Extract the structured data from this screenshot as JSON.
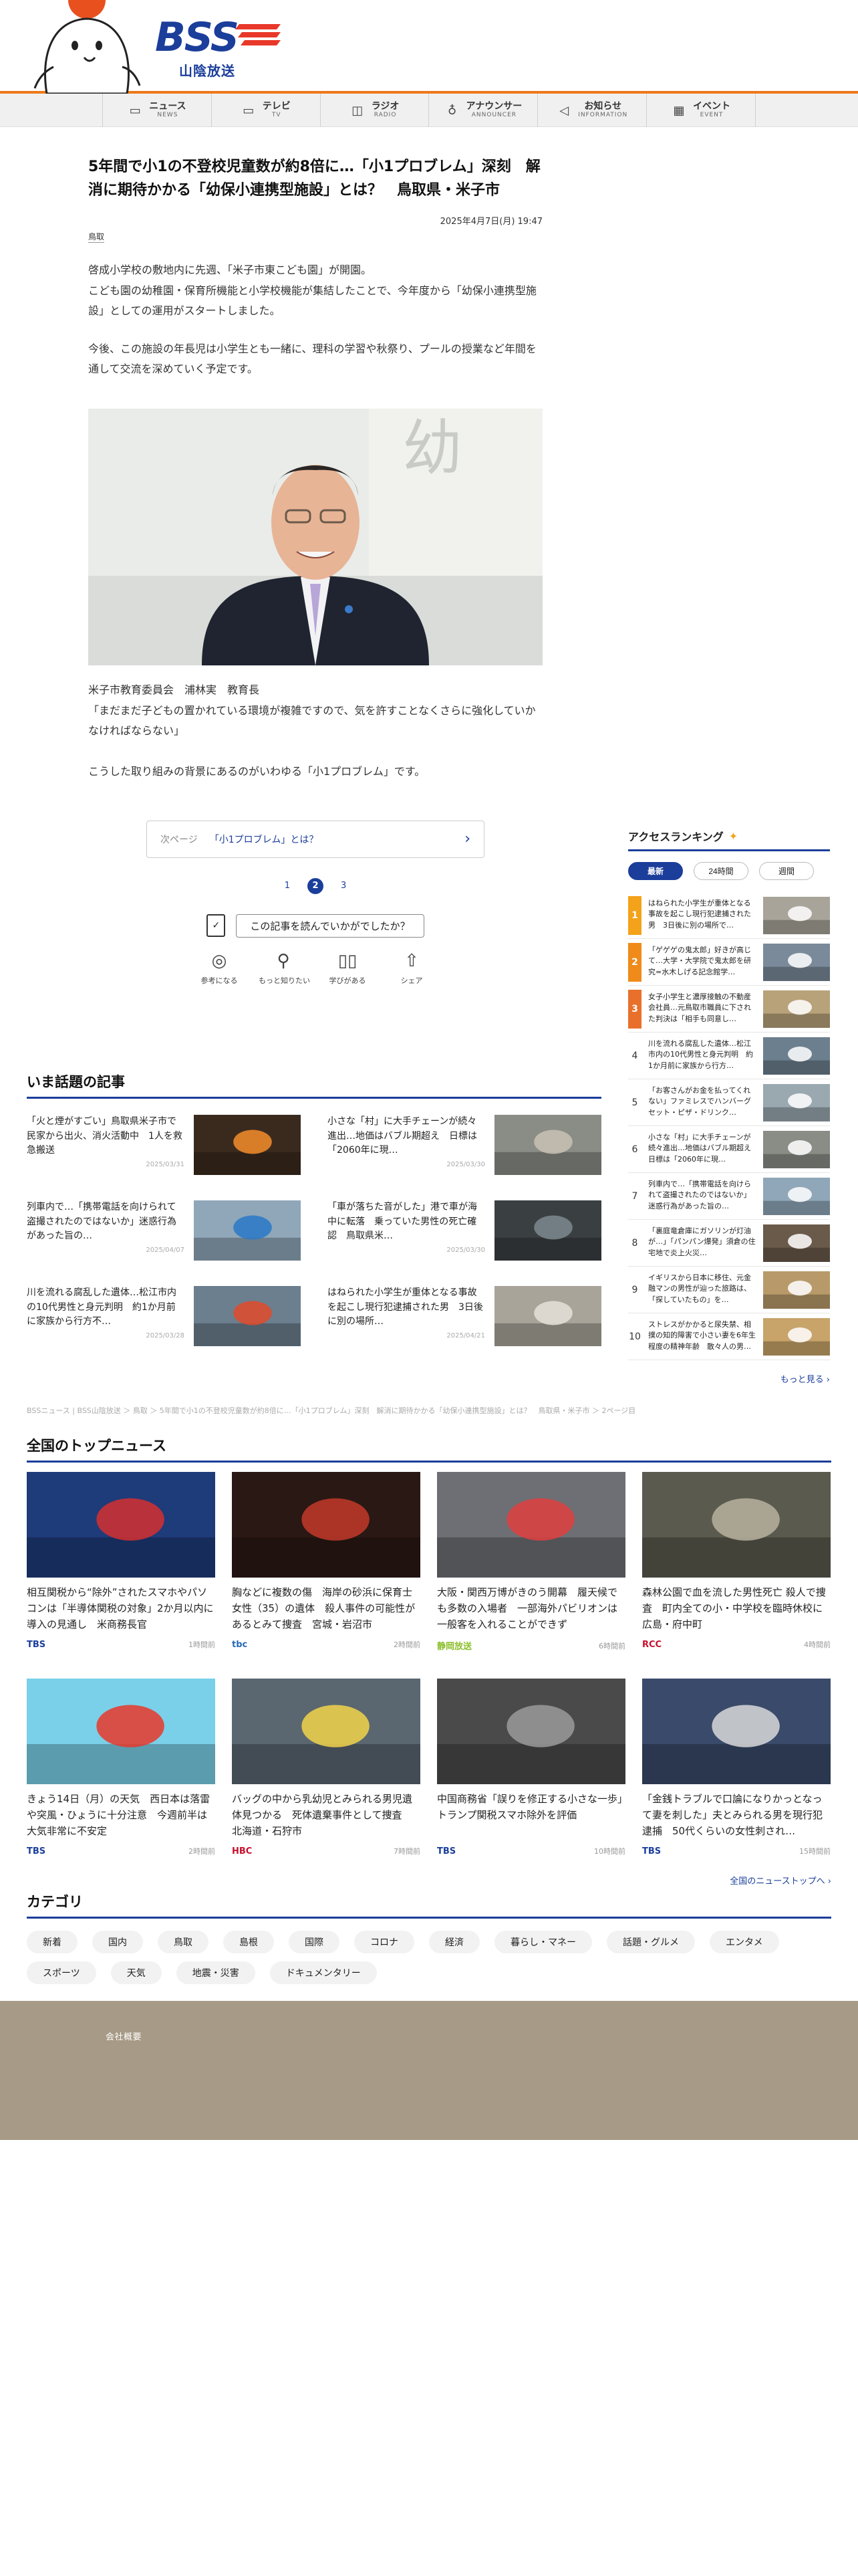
{
  "site": {
    "name": "BSS",
    "subname": "山陰放送"
  },
  "nav": [
    {
      "label": "ニュース",
      "sub": "NEWS",
      "icon": "news-icon",
      "glyph": "▭"
    },
    {
      "label": "テレビ",
      "sub": "TV",
      "icon": "tv-icon",
      "glyph": "▭"
    },
    {
      "label": "ラジオ",
      "sub": "RADIO",
      "icon": "radio-icon",
      "glyph": "◫"
    },
    {
      "label": "アナウンサー",
      "sub": "ANNOUNCER",
      "icon": "microphone-icon",
      "glyph": "♁"
    },
    {
      "label": "お知らせ",
      "sub": "INFORMATION",
      "icon": "megaphone-icon",
      "glyph": "◁"
    },
    {
      "label": "イベント",
      "sub": "EVENT",
      "icon": "calendar-icon",
      "glyph": "▦"
    }
  ],
  "article": {
    "title": "5年間で小1の不登校児童数が約8倍に…「小1プロブレム」深刻　解消に期待かかる「幼保小連携型施設」とは？　鳥取県・米子市",
    "date": "2025年4月7日(月) 19:47",
    "tag": "鳥取",
    "para1": "啓成小学校の敷地内に先週、「米子市東こども園」が開園。\nこども園の幼稚園・保育所機能と小学校機能が集結したことで、今年度から「幼保小連携型施設」としての運用がスタートしました。",
    "para2": "今後、この施設の年長児は小学生とも一緒に、理科の学習や秋祭り、プールの授業など年間を通して交流を深めていく予定です。",
    "caption": "米子市教育委員会　浦林実　教育長\n「まだまだ子どもの置かれている環境が複雑ですので、気を許すことなくさらに強化していかなければならない」",
    "para3": "こうした取り組みの背景にあるのがいわゆる「小1プロブレム」です。"
  },
  "next_page": {
    "label": "次ページ",
    "title": "「小1プロブレム」とは？"
  },
  "pager": {
    "p1": "1",
    "p2": "2",
    "p3": "3"
  },
  "feedback": {
    "question": "この記事を読んでいかがでしたか？",
    "reactions": [
      {
        "label": "参考になる",
        "icon": "lightbulb-icon",
        "glyph": "◎"
      },
      {
        "label": "もっと知りたい",
        "icon": "magnifier-icon",
        "glyph": "⚲"
      },
      {
        "label": "学びがある",
        "icon": "open-book-icon",
        "glyph": "▯▯"
      },
      {
        "label": "シェア",
        "icon": "share-icon",
        "glyph": "⇧"
      }
    ]
  },
  "hot": {
    "heading": "いま話題の記事",
    "items": [
      {
        "title": "「火と煙がすごい」鳥取県米子市で民家から出火、消火活動中　1人を救急搬送",
        "date": "2025/03/31",
        "color": "#3a2a1e",
        "accent": "#f58c2a"
      },
      {
        "title": "小さな「村」に大手チェーンが続々進出…地価はバブル期超え　日標は「2060年に現…",
        "date": "2025/03/30",
        "color": "#8a8d86",
        "accent": "#c8c2b4"
      },
      {
        "title": "列車内で…「携帯電話を向けられて盗撮されたのではないか」迷惑行為があった旨の…",
        "date": "2025/04/07",
        "color": "#8fa7b8",
        "accent": "#2a78c8"
      },
      {
        "title": "「車が落ちた音がした」港で車が海中に転落　乗っていた男性の死亡確認　鳥取県米…",
        "date": "2025/03/30",
        "color": "#3a3f42",
        "accent": "#7d8a8e"
      },
      {
        "title": "川を流れる腐乱した遺体…松江市内の10代男性と身元判明　約1か月前に家族から行方不…",
        "date": "2025/03/28",
        "color": "#6c7f8e",
        "accent": "#e04a2a"
      },
      {
        "title": "はねられた小学生が重体となる事故を起こし現行犯逮捕された男　3日後に別の場所…",
        "date": "2025/04/21",
        "color": "#a8a49a",
        "accent": "#e6e2d8"
      }
    ]
  },
  "breadcrumb": "BSSニュース | BSS山陰放送 ＞ 鳥取 ＞ 5年間で小1の不登校児童数が約8倍に…「小1プロブレム」深刻　解消に期待かかる「幼保小連携型施設」とは？　鳥取県・米子市 ＞ 2ページ目",
  "national": {
    "heading": "全国のトップニュース",
    "more": "全国のニューストップへ",
    "items": [
      {
        "title": "相互関税から“除外”されたスマホやパソコンは「半導体関税の対象」2か月以内に導入の見通し　米商務長官",
        "source": "TBS",
        "source_color": "#1b3e9b",
        "time": "1時間前",
        "color": "#1e3b7a",
        "accent": "#d43030"
      },
      {
        "title": "胸などに複数の傷　海岸の砂浜に保育士女性（35）の遺体　殺人事件の可能性があるとみて捜査　宮城・岩沼市",
        "source": "tbc",
        "source_color": "#2a6ab8",
        "time": "2時間前",
        "color": "#2a1814",
        "accent": "#c23a2a"
      },
      {
        "title": "大阪・関西万博がきのう開幕　履天候でも多数の入場者　一部海外パビリオンは一般客を入れることができず",
        "source": "静岡放送",
        "source_color": "#8bbf2a",
        "time": "6時間前",
        "color": "#6d6f74",
        "accent": "#e04040"
      },
      {
        "title": "森林公園で血を流した男性死亡 殺人で捜査　町内全ての小・中学校を臨時休校に　広島・府中町",
        "source": "RCC",
        "source_color": "#c8102e",
        "time": "4時間前",
        "color": "#5a5a4e",
        "accent": "#b8b2a0"
      },
      {
        "title": "きょう14日（月）の天気　西日本は落雷や突風・ひょうに十分注意　今週前半は大気非常に不安定",
        "source": "TBS",
        "source_color": "#1b3e9b",
        "time": "2時間前",
        "color": "#7ad0e8",
        "accent": "#e8382a"
      },
      {
        "title": "バッグの中から乳幼児とみられる男児遺体見つかる　死体遺棄事件として捜査　北海道・石狩市",
        "source": "HBC",
        "source_color": "#c8102e",
        "time": "7時間前",
        "color": "#5a6670",
        "accent": "#f2d44a"
      },
      {
        "title": "中国商務省「誤りを修正する小さな一歩」トランプ関税スマホ除外を評価",
        "source": "TBS",
        "source_color": "#1b3e9b",
        "time": "10時間前",
        "color": "#4a4a4a",
        "accent": "#9a9a9a"
      },
      {
        "title": "「金銭トラブルで口論になりかっとなって妻を刺した」夫とみられる男を現行犯逮捕　50代くらいの女性刺され…",
        "source": "TBS",
        "source_color": "#1b3e9b",
        "time": "15時間前",
        "color": "#3a4a6a",
        "accent": "#d8d8d8"
      }
    ]
  },
  "categories": {
    "heading": "カテゴリ",
    "items": [
      "新着",
      "国内",
      "鳥取",
      "島根",
      "国際",
      "コロナ",
      "経済",
      "暮らし・マネー",
      "話題・グルメ",
      "エンタメ",
      "スポーツ",
      "天気",
      "地震・災害",
      "ドキュメンタリー"
    ]
  },
  "ranking": {
    "heading": "アクセスランキング",
    "tabs": [
      "最新",
      "24時間",
      "週間"
    ],
    "more": "もっと見る",
    "items": [
      {
        "num": "1",
        "title": "はねられた小学生が重体となる事故を起こし現行犯逮捕された男　3日後に別の場所で…",
        "color": "#a8a49a",
        "badge": "#f4a21a"
      },
      {
        "num": "2",
        "title": "「ゲゲゲの鬼太郎」好きが高じて…大学・大学院で鬼太郎を研究=水木しげる記念館学…",
        "color": "#7a8a9a",
        "badge": "#f08a1a"
      },
      {
        "num": "3",
        "title": "女子小学生と濃厚接触の不動産会社員…元鳥取市職員に下された判決は「相手も同意し…",
        "color": "#b8a27a",
        "badge": "#e8702a"
      },
      {
        "num": "4",
        "title": "川を流れる腐乱した遺体…松江市内の10代男性と身元判明　約1か月前に家族から行方…",
        "color": "#6c7f8e",
        "badge": ""
      },
      {
        "num": "5",
        "title": "「お客さんがお金を払ってくれない」ファミレスでハンバーグセット・ピザ・ドリンク…",
        "color": "#9aa8b0",
        "badge": ""
      },
      {
        "num": "6",
        "title": "小さな「村」に大手チェーンが続々進出…地価はバブル期超え　日標は「2060年に現…",
        "color": "#8a8d86",
        "badge": ""
      },
      {
        "num": "7",
        "title": "列車内で…「携帯電話を向けられて盗撮されたのではないか」迷惑行為があった旨の…",
        "color": "#8fa7b8",
        "badge": ""
      },
      {
        "num": "8",
        "title": "「裏庭竜倉庫にガソリンが灯油が…」「パンパン爆発」須倉の住宅地で炎上火災…",
        "color": "#6a5a4a",
        "badge": ""
      },
      {
        "num": "9",
        "title": "イギリスから日本に移住、元金融マンの男性が辿った旅路は、「探していたもの」を…",
        "color": "#b89a6a",
        "badge": ""
      },
      {
        "num": "10",
        "title": "ストレスがかかると尿失禁、相撲の知的障害で小さい妻を6年生程度の精神年齢　散々人の男…",
        "color": "#c8a46a",
        "badge": ""
      }
    ]
  }
}
